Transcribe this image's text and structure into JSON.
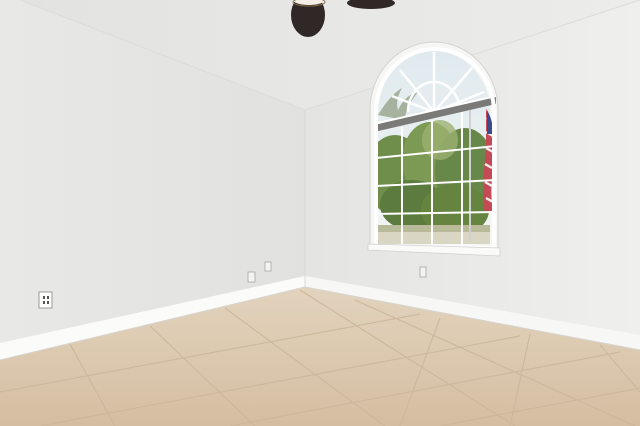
{
  "scene": {
    "subject": "empty-room-interior",
    "palette": {
      "ceiling": "#e4e4e2",
      "left_wall": "#e6e6e4",
      "right_wall": "#ebebe9",
      "baseboard": "#fafaf8",
      "floor": "#dcc9b0",
      "tile_grout": "#c9b69c",
      "window_frame": "#f7f7f5",
      "window_mullion": "#ffffff",
      "sky": "#e7eef0",
      "trees": "#6e8a4a",
      "fan": "#2e2826"
    },
    "elements": [
      "ceiling",
      "ceiling-fan",
      "left-wall",
      "right-wall",
      "arched-window",
      "american-flag",
      "tile-floor",
      "baseboard",
      "electrical-outlet"
    ]
  }
}
